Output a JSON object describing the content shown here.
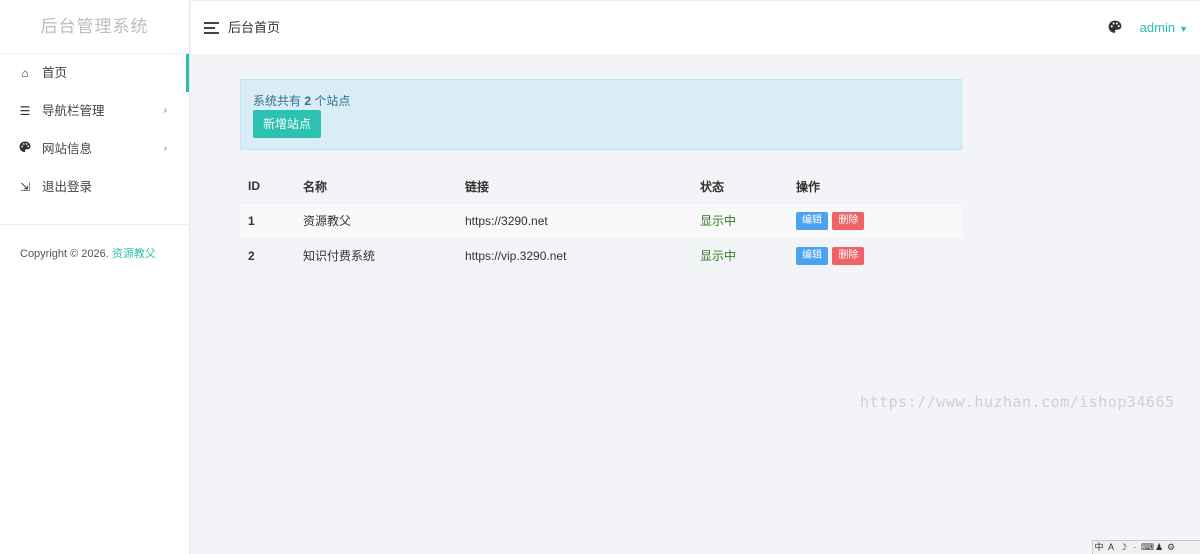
{
  "sidebar": {
    "brand": "后台管理系统",
    "items": [
      {
        "label": "首页",
        "icon": "home-icon",
        "glyph": "⌂",
        "active": true,
        "has_children": false
      },
      {
        "label": "导航栏管理",
        "icon": "list-icon",
        "glyph": "☰",
        "active": false,
        "has_children": true
      },
      {
        "label": "网站信息",
        "icon": "palette-icon",
        "glyph": "●",
        "active": false,
        "has_children": true
      },
      {
        "label": "退出登录",
        "icon": "logout-icon",
        "glyph": "⇲",
        "active": false,
        "has_children": false
      }
    ],
    "copyright_prefix": "Copyright © 2026.",
    "copyright_link": "资源教父"
  },
  "header": {
    "title": "后台首页",
    "user": "admin"
  },
  "alert": {
    "prefix": "系统共有",
    "count": "2",
    "suffix": "个站点",
    "add_button": "新增站点"
  },
  "table": {
    "columns": [
      "ID",
      "名称",
      "链接",
      "状态",
      "操作"
    ],
    "rows": [
      {
        "id": "1",
        "name": "资源教父",
        "url": "https://3290.net",
        "status": "显示中"
      },
      {
        "id": "2",
        "name": "知识付费系统",
        "url": "https://vip.3290.net",
        "status": "显示中"
      }
    ],
    "edit_label": "编辑",
    "delete_label": "删除"
  },
  "watermark": "https://www.huzhan.com/ishop34665",
  "colors": {
    "accent": "#2cc1b0",
    "alert_bg": "#d9edf7",
    "status_green": "#2e7d1e",
    "edit_blue": "#4aa3f0",
    "delete_red": "#f0626a"
  }
}
